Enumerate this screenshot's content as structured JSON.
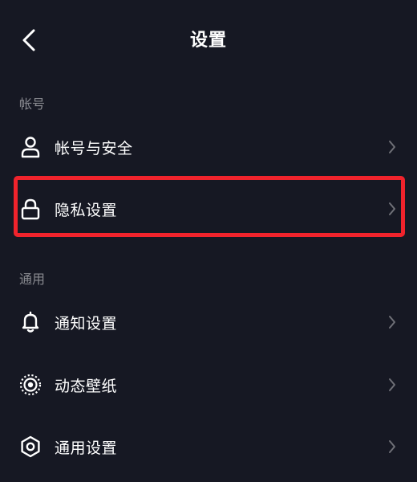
{
  "header": {
    "title": "设置",
    "back_icon": "chevron-left-icon"
  },
  "sections": [
    {
      "label": "帐号",
      "items": [
        {
          "label": "帐号与安全",
          "icon": "user-icon"
        },
        {
          "label": "隐私设置",
          "icon": "lock-icon",
          "highlighted": true
        }
      ]
    },
    {
      "label": "通用",
      "items": [
        {
          "label": "通知设置",
          "icon": "bell-icon"
        },
        {
          "label": "动态壁纸",
          "icon": "live-wallpaper-icon"
        },
        {
          "label": "通用设置",
          "icon": "gear-icon"
        }
      ]
    }
  ],
  "colors": {
    "background": "#161823",
    "text": "#ffffff",
    "muted": "#8a8b91",
    "highlight": "#f0232c"
  }
}
